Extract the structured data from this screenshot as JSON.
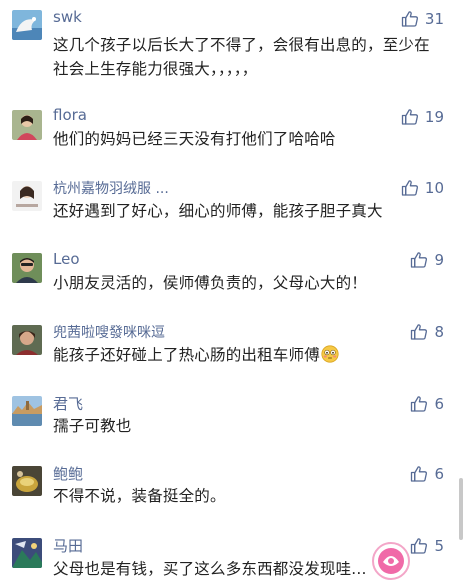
{
  "comments": [
    {
      "user": "swk",
      "likes": "31",
      "text": "这几个孩子以后长大了不得了，会很有出息的，至少在社会上生存能力很强大，，，，，"
    },
    {
      "user": "flora",
      "likes": "19",
      "text": "他们的妈妈已经三天没有打他们了哈哈哈"
    },
    {
      "user": "杭州嘉物羽绒服 ...",
      "likes": "10",
      "text": "还好遇到了好心，细心的师傅，能孩子胆子真大"
    },
    {
      "user": "Leo",
      "likes": "9",
      "text": "小朋友灵活的，侯师傅负责的，父母心大的！"
    },
    {
      "user": "兜茜啦嗖發咪咪逗",
      "likes": "8",
      "text": "能孩子还好碰上了热心肠的出租车师傅"
    },
    {
      "user": "君飞",
      "likes": "6",
      "text": "孺子可教也"
    },
    {
      "user": "鲍鲍",
      "likes": "6",
      "text": "不得不说，装备挺全的。"
    },
    {
      "user": "马田",
      "likes": "5",
      "text": "父母也是有钱，买了这么多东西都没发现哇..."
    }
  ],
  "icons": {
    "like": "thumbs-up-outline-icon",
    "emoji": "flushed-face-emoji"
  },
  "colors": {
    "username": "#576b95",
    "text": "#222222",
    "background": "#ffffff"
  }
}
